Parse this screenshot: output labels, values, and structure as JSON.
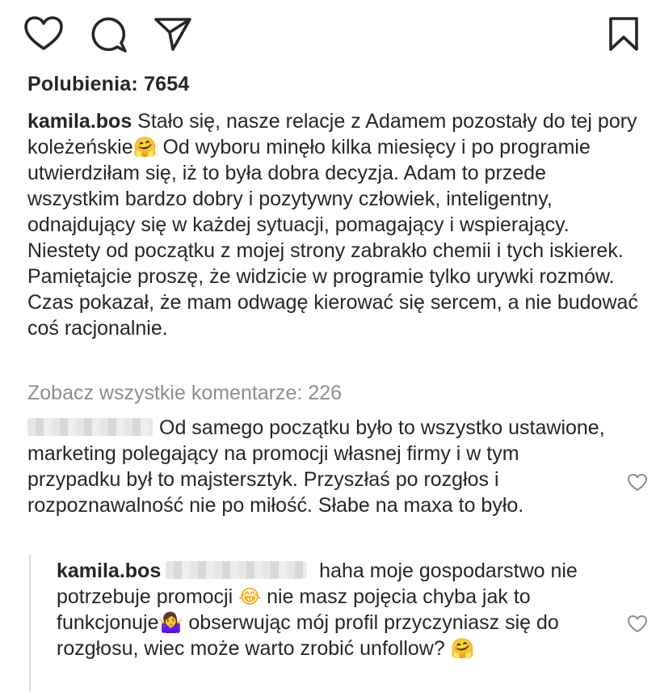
{
  "actions": {
    "like_icon": "heart-icon",
    "comment_icon": "comment-bubble-icon",
    "share_icon": "paper-plane-icon",
    "save_icon": "bookmark-icon"
  },
  "likes": {
    "text": "Polubienia: 7654"
  },
  "caption": {
    "username": "kamila.bos",
    "text_before_emoji": " Stało się, nasze relacje z Adamem pozostały do tej pory koleżeńskie",
    "emoji": "🤗",
    "text_after_emoji": " Od wyboru minęło kilka miesięcy i po programie utwierdziłam się, iż to była dobra decyzja. Adam to przede wszystkim bardzo dobry i pozytywny człowiek, inteligentny, odnajdujący się w każdej sytuacji, pomagający i wspierający. Niestety od początku z mojej strony zabrakło chemii i tych iskierek. Pamiętajcie proszę, że widzicie w programie tylko urywki rozmów. Czas pokazał, że mam odwagę kierować się sercem, a nie budować coś racjonalnie."
  },
  "view_comments": {
    "text": "Zobacz wszystkie komentarze: 226"
  },
  "comment": {
    "text": "Od samego początku było to wszystko ustawione, marketing polegający na promocji własnej firmy i w tym przypadku był to majstersztyk. Przyszłaś po rozgłos i rozpoznawalność nie po miłość. Słabe na maxa to było."
  },
  "reply": {
    "username": "kamila.bos",
    "text_1": " haha moje gospodarstwo nie potrzebuje promocji ",
    "emoji_1": "😂",
    "text_2": " nie masz pojęcia chyba jak to funkcjonuje",
    "emoji_2": "🤷‍♀️",
    "text_3": " obserwując mój profil przyczyniasz się do rozgłosu, wiec może warto zrobić unfollow? ",
    "emoji_3": "🤗"
  },
  "colors": {
    "text": "#262626",
    "secondary_text": "#8e8e8e",
    "reply_line": "#dbdbdb"
  }
}
